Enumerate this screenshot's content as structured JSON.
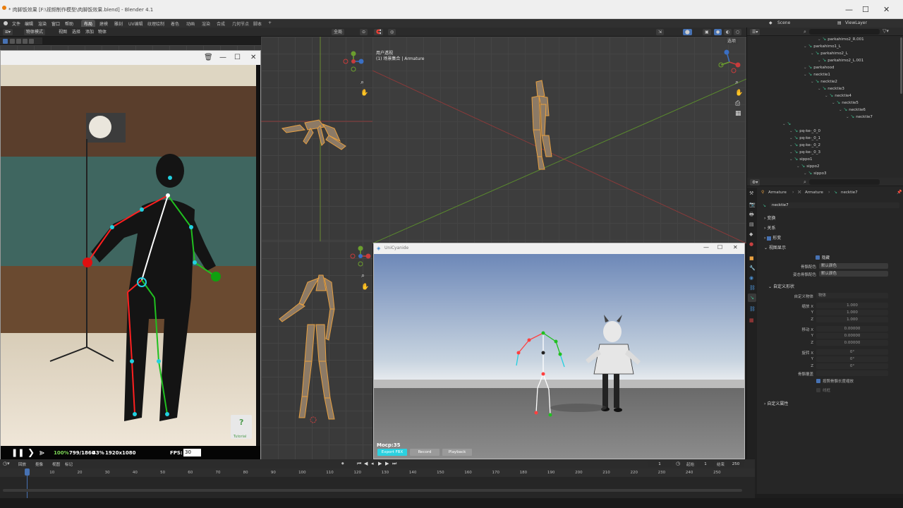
{
  "title_bar": {
    "window_title": "* 肉脚饭效果 [F:\\视频制作模型\\肉脚饭效果.blend] - Blender 4.1",
    "minimize": "—",
    "maximize": "☐",
    "close": "✕"
  },
  "menu": {
    "items": [
      "文件",
      "编辑",
      "渲染",
      "窗口",
      "帮助"
    ],
    "workspace_tabs": [
      "布局",
      "建模",
      "雕刻",
      "UV编辑",
      "纹理绘制",
      "着色",
      "动画",
      "渲染",
      "合成",
      "几何节点",
      "脚本"
    ],
    "active_tab": "布局",
    "add_tab": "+",
    "scene": "Scene",
    "view_layer": "ViewLayer"
  },
  "viewport_header": {
    "mode": "物体模式",
    "menus": [
      "视图",
      "选择",
      "添加",
      "物体"
    ],
    "transform_orientation": "全局",
    "options": "选项"
  },
  "viewport_main": {
    "label_line1": "用户透视",
    "label_line2": "(1) 场景集合 | Armature"
  },
  "mocap_window": {
    "help_label": "Tutorial",
    "status_progress": "100%",
    "status_frames": "799/1860",
    "status_cpu": "43%",
    "status_resolution": "1920x1080",
    "fps_label": "FPS:",
    "fps_value": "30"
  },
  "unity_window": {
    "title": "UniCyanide",
    "mocap_label": "Mocp:35",
    "buttons": [
      "Export FBX",
      "Record",
      "Playback"
    ]
  },
  "outliner": {
    "search_placeholder": "",
    "rows": [
      {
        "name": "parkahimo2_R.001",
        "indent": 6
      },
      {
        "name": "parkahimo1_L",
        "indent": 4
      },
      {
        "name": "parkahimo2_L",
        "indent": 5
      },
      {
        "name": "parkahimo2_L.001",
        "indent": 6
      },
      {
        "name": "parkahood",
        "indent": 4
      },
      {
        "name": "necktie1",
        "indent": 4
      },
      {
        "name": "necktie2",
        "indent": 5
      },
      {
        "name": "necktie3",
        "indent": 6
      },
      {
        "name": "necktie4",
        "indent": 7
      },
      {
        "name": "necktie5",
        "indent": 8
      },
      {
        "name": "necktie6",
        "indent": 9
      },
      {
        "name": "necktie7",
        "indent": 10
      },
      {
        "name": "",
        "indent": 1
      },
      {
        "name": "pq-ke-_0_0",
        "indent": 2
      },
      {
        "name": "pq-ke-_0_1",
        "indent": 2
      },
      {
        "name": "pq-ke-_0_2",
        "indent": 2
      },
      {
        "name": "pq-ke-_0_3",
        "indent": 2
      },
      {
        "name": "sippo1",
        "indent": 2
      },
      {
        "name": "sippo2",
        "indent": 3
      },
      {
        "name": "sippo3",
        "indent": 4
      },
      {
        "name": "sippo4",
        "indent": 5
      }
    ]
  },
  "properties": {
    "breadcrumb": [
      "Armature",
      "Armature",
      "necktie7"
    ],
    "bone_name": "necktie7",
    "sections": {
      "transform": "变换",
      "relations": "关系",
      "deform": "形变",
      "viewport_display": "视图显示",
      "custom_shape": "自定义形状",
      "custom_props": "自定义属性"
    },
    "hide_label": "隐藏",
    "bone_color_label": "骨骼配色",
    "bone_color_value": "默认颜色",
    "pose_bone_color_label": "姿态骨骼配色",
    "pose_bone_color_value": "默认颜色",
    "custom_object_label": "自定义物体",
    "custom_object_value": "物体",
    "scale_labels": [
      "缩放 X",
      "Y",
      "Z"
    ],
    "scale_values": [
      "1.000",
      "1.000",
      "1.000"
    ],
    "translation_labels": [
      "移动 X",
      "Y",
      "Z"
    ],
    "translation_values": [
      "0.00000",
      "0.00000",
      "0.00000"
    ],
    "rotation_labels": [
      "旋转 X",
      "Y",
      "Z"
    ],
    "rotation_values": [
      "0°",
      "0°",
      "0°"
    ],
    "override_label": "骨骼覆盖",
    "scale_to_bone_label": "按照骨骼长度缩放",
    "wireframe_label": "线框"
  },
  "timeline": {
    "menus": [
      "回放",
      "抠像",
      "视图",
      "标记"
    ],
    "current_frame": "1",
    "start_label": "起始",
    "start_value": "1",
    "end_label": "结束",
    "end_value": "250",
    "ticks": [
      "1",
      "10",
      "20",
      "30",
      "40",
      "50",
      "60",
      "70",
      "80",
      "90",
      "100",
      "110",
      "120",
      "130",
      "140",
      "150",
      "160",
      "170",
      "180",
      "190",
      "200",
      "210",
      "220",
      "230",
      "240",
      "250"
    ]
  },
  "colors": {
    "accent_blue": "#4772b3",
    "bone_green": "#3fb68b",
    "cyan_button": "#2bd1e0",
    "armature_orange": "#e8a040"
  }
}
